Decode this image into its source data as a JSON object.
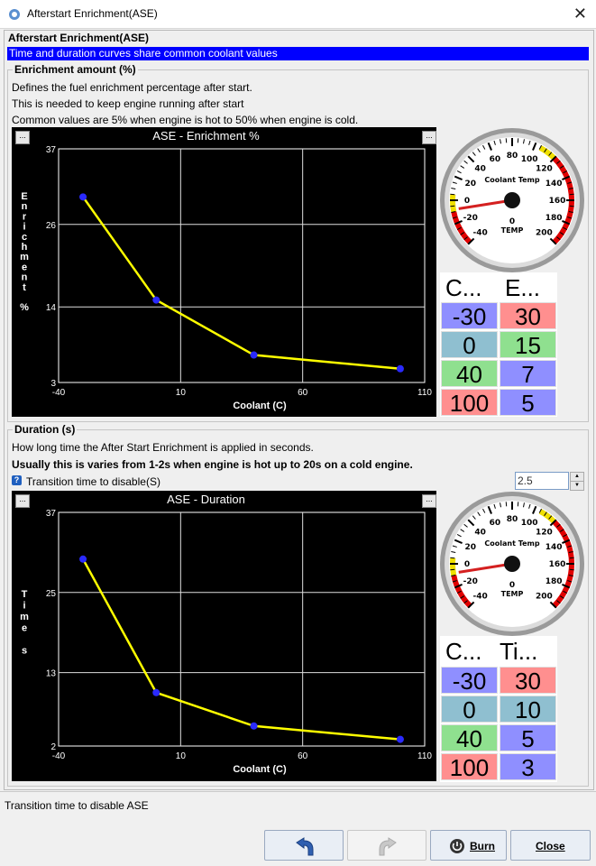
{
  "window": {
    "title": "Afterstart Enrichment(ASE)"
  },
  "panel": {
    "title": "Afterstart Enrichment(ASE)",
    "banner": "Time and duration curves share common coolant values"
  },
  "enrichment": {
    "group_title": "Enrichment amount (%)",
    "desc1": "Defines the fuel enrichment percentage after start.",
    "desc2": "This is needed to keep engine running after start",
    "desc3": "Common values are 5% when engine is hot to 50% when engine is cold.",
    "chart_title": "ASE - Enrichment %",
    "menu_left": "...",
    "menu_right": "...",
    "table": {
      "col1": "C...",
      "col2": "E...",
      "rows": [
        [
          "-30",
          "30"
        ],
        [
          "0",
          "15"
        ],
        [
          "40",
          "7"
        ],
        [
          "100",
          "5"
        ]
      ]
    }
  },
  "duration": {
    "group_title": "Duration (s)",
    "desc1": "How long time the After Start Enrichment is applied in seconds.",
    "desc2": "Usually this is varies from 1-2s when engine is hot up to 20s on a cold engine.",
    "transition_label": "Transition time to disable(S)",
    "transition_value": "2.5",
    "chart_title": "ASE - Duration",
    "menu_left": "...",
    "menu_right": "...",
    "table": {
      "col1": "C...",
      "col2": "Ti...",
      "rows": [
        [
          "-30",
          "30"
        ],
        [
          "0",
          "10"
        ],
        [
          "40",
          "5"
        ],
        [
          "100",
          "3"
        ]
      ]
    }
  },
  "gauge": {
    "title": "Coolant Temp",
    "units": "TEMP",
    "readout": "0",
    "ticks": [
      "-40",
      "-20",
      "0",
      "20",
      "40",
      "60",
      "80",
      "100",
      "120",
      "140",
      "160",
      "180",
      "200"
    ],
    "value": -40
  },
  "statusbar": {
    "text": "Transition time to disable ASE"
  },
  "buttons": {
    "undo_icon": "undo-icon",
    "redo_icon": "redo-icon",
    "burn": "Burn",
    "close": "Close"
  },
  "colors": {
    "curve": "#ffff00",
    "point": "#2a2aff",
    "banner": "#0000ff",
    "cold_cell": "#8f8fff",
    "hot_cell": "#ff8f8f",
    "mid_cell": "#8fbfd0",
    "green_cell": "#8fe08f"
  },
  "chart_data": [
    {
      "type": "line",
      "title": "ASE - Enrichment %",
      "xlabel": "Coolant (C)",
      "ylabel": "Enrichment %",
      "x": [
        -30,
        0,
        40,
        100
      ],
      "y": [
        30,
        15,
        7,
        5
      ],
      "xlim": [
        -40,
        110
      ],
      "ylim": [
        3,
        37
      ],
      "xticks": [
        "-40",
        "10",
        "60",
        "110"
      ],
      "yticks": [
        "37",
        "26",
        "14",
        "3"
      ],
      "grid": true
    },
    {
      "type": "line",
      "title": "ASE - Duration",
      "xlabel": "Coolant (C)",
      "ylabel": "Time s",
      "x": [
        -30,
        0,
        40,
        100
      ],
      "y": [
        30,
        10,
        5,
        3
      ],
      "xlim": [
        -40,
        110
      ],
      "ylim": [
        2,
        37
      ],
      "xticks": [
        "-40",
        "10",
        "60",
        "110"
      ],
      "yticks": [
        "37",
        "25",
        "13",
        "2"
      ],
      "grid": true
    }
  ]
}
